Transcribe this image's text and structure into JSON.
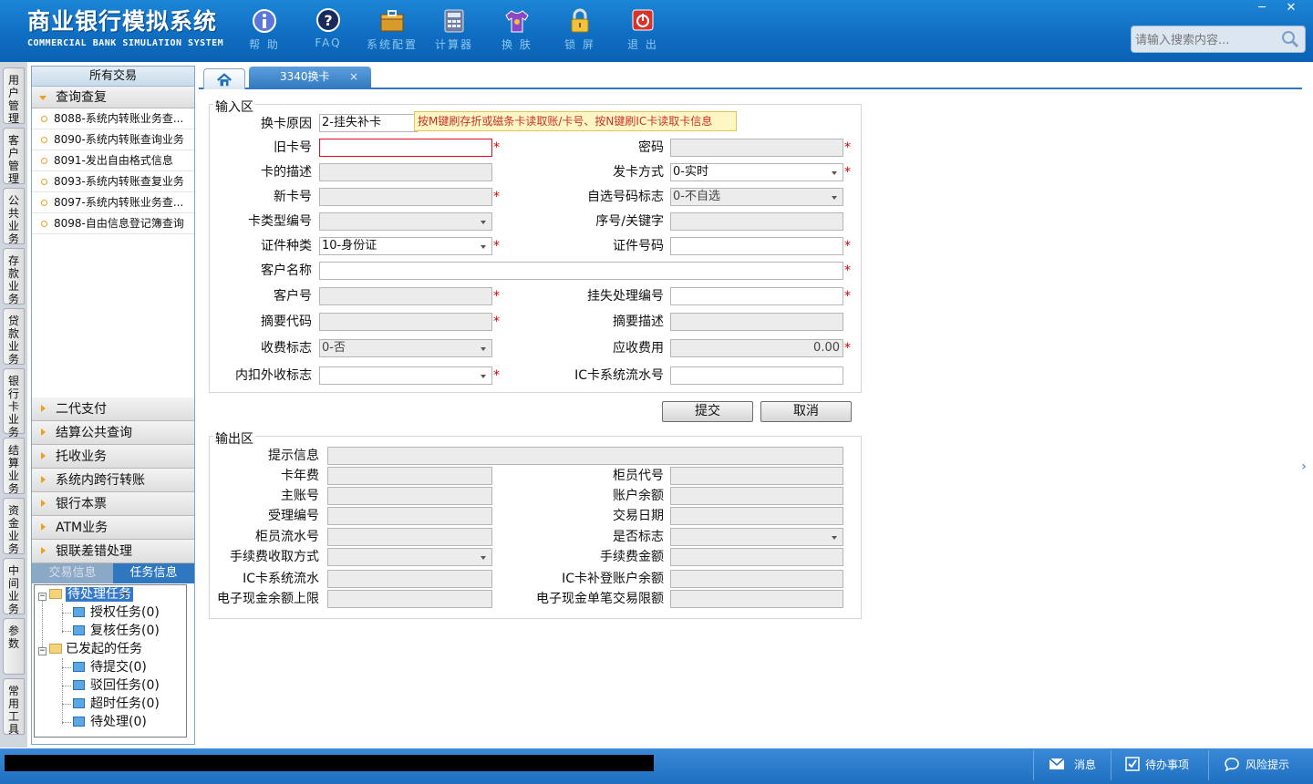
{
  "app": {
    "title_cn": "商业银行模拟系统",
    "title_en": "COMMERCIAL BANK SIMULATION SYSTEM"
  },
  "toolbar": [
    {
      "label": "帮 助",
      "icon": "info-icon"
    },
    {
      "label": "FAQ",
      "icon": "help-icon"
    },
    {
      "label": "系统配置",
      "icon": "toolbox-icon"
    },
    {
      "label": "计算器",
      "icon": "calculator-icon"
    },
    {
      "label": "换 肤",
      "icon": "shirt-icon"
    },
    {
      "label": "锁 屏",
      "icon": "lock-icon"
    },
    {
      "label": "退 出",
      "icon": "power-icon"
    }
  ],
  "window_controls": {
    "minimize": "─",
    "close": "✕"
  },
  "search": {
    "placeholder": "请输入搜索内容...",
    "value": ""
  },
  "left_tabs": [
    "用户管理",
    "客户管理",
    "公共业务",
    "存款业务",
    "贷款业务",
    "银行卡业务",
    "结算业务",
    "资金业务",
    "中间业务",
    "参数",
    "常用工具"
  ],
  "nav": {
    "header": "所有交易",
    "open_section": "查询查复",
    "items": [
      "8088-系统内转账业务查...",
      "8090-系统内转账查询业务",
      "8091-发出自由格式信息",
      "8093-系统内转账查复业务",
      "8097-系统内转账业务查...",
      "8098-自由信息登记簿查询"
    ],
    "sections": [
      "二代支付",
      "结算公共查询",
      "托收业务",
      "系统内跨行转账",
      "银行本票",
      "ATM业务",
      "银联差错处理"
    ],
    "info_tabs": [
      "交易信息",
      "任务信息"
    ],
    "tree": {
      "pending": "待处理任务",
      "auth": "授权任务(0)",
      "review": "复核任务(0)",
      "initiated": "已发起的任务",
      "to_submit": "待提交(0)",
      "rejected": "驳回任务(0)",
      "timeout": "超时任务(0)",
      "to_process": "待处理(0)"
    }
  },
  "tabs": {
    "doc": "3340换卡",
    "close": "×"
  },
  "form": {
    "input_legend": "输入区",
    "output_legend": "输出区",
    "tip": "按M键刷存折或磁条卡读取账/卡号、按N键刷IC卡读取卡信息",
    "fields": {
      "reason": {
        "label": "换卡原因",
        "value": "2-挂失补卡"
      },
      "old_card": {
        "label": "旧卡号",
        "value": ""
      },
      "password": {
        "label": "密码",
        "value": ""
      },
      "card_desc": {
        "label": "卡的描述",
        "value": ""
      },
      "issue_mode": {
        "label": "发卡方式",
        "value": "0-实时"
      },
      "new_card": {
        "label": "新卡号",
        "value": ""
      },
      "self_select": {
        "label": "自选号码标志",
        "value": "0-不自选"
      },
      "card_type": {
        "label": "卡类型编号",
        "value": ""
      },
      "seq_key": {
        "label": "序号/关键字",
        "value": ""
      },
      "id_type": {
        "label": "证件种类",
        "value": "10-身份证"
      },
      "id_no": {
        "label": "证件号码",
        "value": ""
      },
      "cust_name": {
        "label": "客户名称",
        "value": ""
      },
      "cust_no": {
        "label": "客户号",
        "value": ""
      },
      "loss_no": {
        "label": "挂失处理编号",
        "value": ""
      },
      "summary_code": {
        "label": "摘要代码",
        "value": ""
      },
      "summary_desc": {
        "label": "摘要描述",
        "value": ""
      },
      "fee_flag": {
        "label": "收费标志",
        "value": "0-否"
      },
      "fee_due": {
        "label": "应收费用",
        "value": "0.00"
      },
      "inout_flag": {
        "label": "内扣外收标志",
        "value": ""
      },
      "ic_serial": {
        "label": "IC卡系统流水号",
        "value": ""
      }
    },
    "buttons": {
      "submit": "提交",
      "cancel": "取消"
    },
    "output": {
      "message": "提示信息",
      "card_fee": "卡年费",
      "teller_code": "柜员代号",
      "main_acct": "主账号",
      "balance": "账户余额",
      "accept_no": "受理编号",
      "trade_date": "交易日期",
      "teller_serial": "柜员流水号",
      "yes_no": "是否标志",
      "fee_method": "手续费收取方式",
      "fee_amount": "手续费金额",
      "ic_serial": "IC卡系统流水",
      "ic_balance": "IC卡补登账户余额",
      "ecash_limit": "电子现金余额上限",
      "ecash_single": "电子现金单笔交易限额"
    }
  },
  "status": {
    "message": "消息",
    "todo": "待办事项",
    "risk": "风险提示"
  }
}
